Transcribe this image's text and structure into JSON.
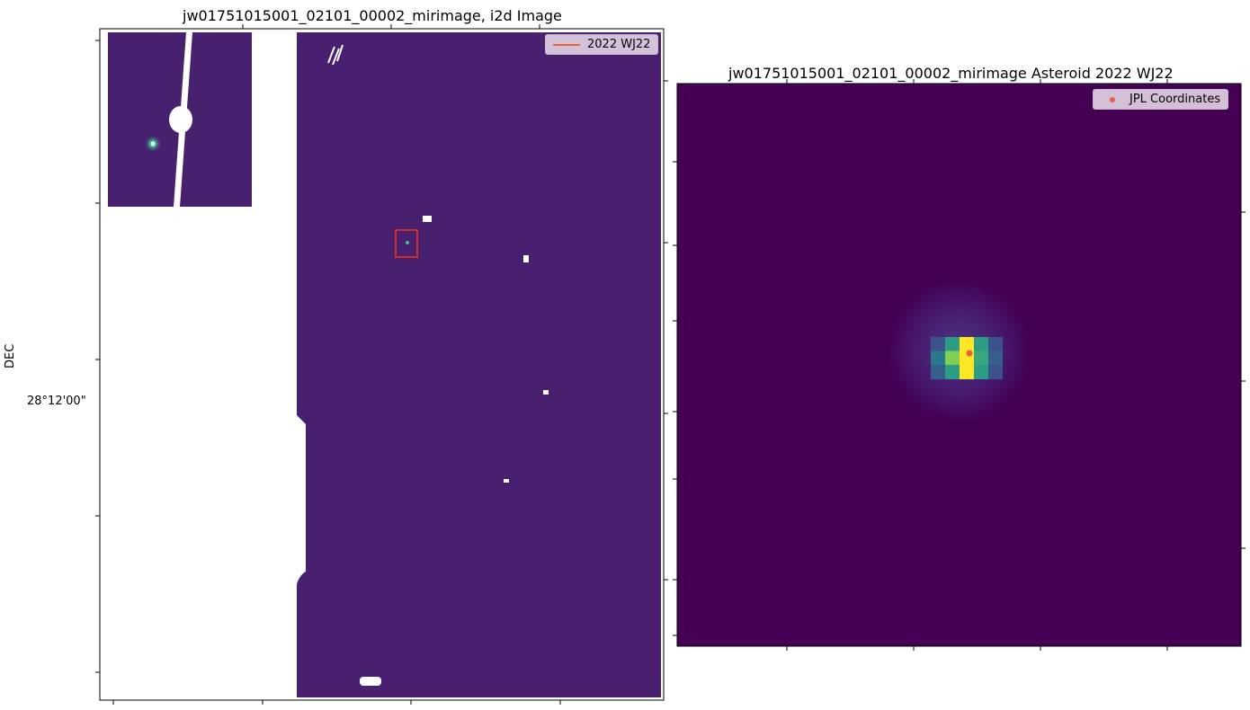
{
  "chart_data": [
    {
      "type": "heatmap",
      "title": "jw01751015001_02101_00002_mirimage,  i2d Image",
      "xlabel": "",
      "ylabel": "DEC",
      "yticklabels": [
        "28°12'00\""
      ],
      "legend": [
        {
          "name": "2022 WJ22",
          "color": "#e8603c",
          "marker": "line"
        }
      ],
      "legend_position": "top-right",
      "colormap": "viridis",
      "highlight_box": {
        "label": "2022 WJ22",
        "color": "#c8302a"
      }
    },
    {
      "type": "heatmap",
      "title": "jw01751015001_02101_00002_mirimage Asteroid 2022 WJ22",
      "legend": [
        {
          "name": "JPL Coordinates",
          "color": "#e8603c",
          "marker": "dot"
        }
      ],
      "legend_position": "top-right",
      "colormap": "viridis",
      "peak_pixels": [
        {
          "col": 0,
          "row": 0,
          "level": 0.25
        },
        {
          "col": 1,
          "row": 0,
          "level": 0.55
        },
        {
          "col": 2,
          "row": 0,
          "level": 1.0
        },
        {
          "col": 3,
          "row": 0,
          "level": 0.55
        },
        {
          "col": 4,
          "row": 0,
          "level": 0.25
        },
        {
          "col": 0,
          "row": 1,
          "level": 0.4
        },
        {
          "col": 1,
          "row": 1,
          "level": 0.8
        },
        {
          "col": 2,
          "row": 1,
          "level": 1.0
        },
        {
          "col": 3,
          "row": 1,
          "level": 0.6
        },
        {
          "col": 4,
          "row": 1,
          "level": 0.3
        },
        {
          "col": 0,
          "row": 2,
          "level": 0.3
        },
        {
          "col": 1,
          "row": 2,
          "level": 0.55
        },
        {
          "col": 2,
          "row": 2,
          "level": 1.0
        },
        {
          "col": 3,
          "row": 2,
          "level": 0.55
        },
        {
          "col": 4,
          "row": 2,
          "level": 0.25
        }
      ]
    }
  ]
}
